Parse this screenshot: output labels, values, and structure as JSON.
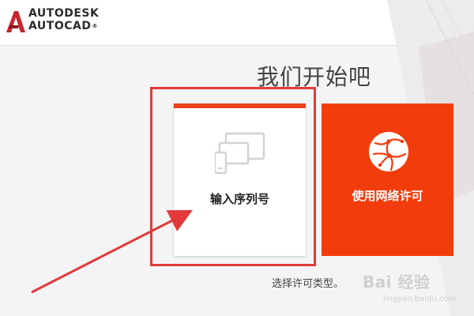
{
  "header": {
    "brand_line1": "AUTODESK",
    "brand_line2": "AUTOCAD",
    "registered_mark": "®",
    "logo_icon": "autodesk-a-logo"
  },
  "heading": "我们开始吧",
  "tiles": [
    {
      "label": "输入序列号",
      "icon": "devices-icon",
      "accent": "#e8421e",
      "background": "#ffffff"
    },
    {
      "label": "使用网络许可",
      "icon": "network-globe-icon",
      "background": "#f23c0c"
    }
  ],
  "hint": "选择许可类型。",
  "watermark": {
    "brand": "Bai 经验",
    "url": "jingyan.baidu.com"
  },
  "colors": {
    "brand_red": "#e8421e",
    "network_tile": "#f23c0c",
    "annotation": "#e23a3a"
  }
}
